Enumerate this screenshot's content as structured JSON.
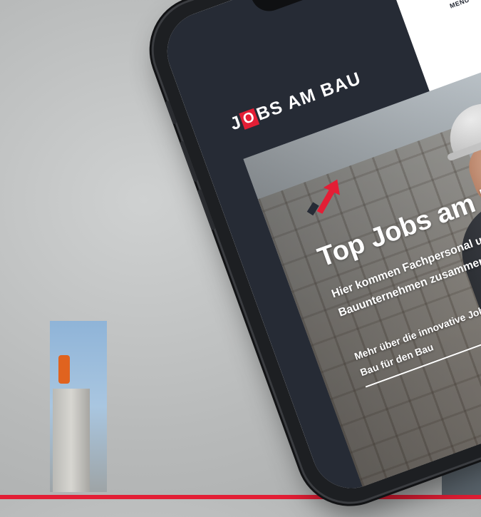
{
  "site": {
    "logo": {
      "before": "J",
      "highlight": "O",
      "after": "BS AM BAU"
    },
    "menu_label": "MENÜ"
  },
  "hero": {
    "title": "Top Jobs am Bau.",
    "subtitle": "Hier kommen Fachpersonal und Bauunternehmen zusammen.",
    "link_text": "Mehr über die innovative Jobplattform vom Bau für den Bau"
  },
  "icons": {
    "brand_arrow": "arrow-up-right-icon",
    "menu": "hamburger-menu-icon"
  },
  "colors": {
    "brand_red": "#e31e35",
    "dark_panel": "#262b35",
    "white": "#ffffff"
  }
}
